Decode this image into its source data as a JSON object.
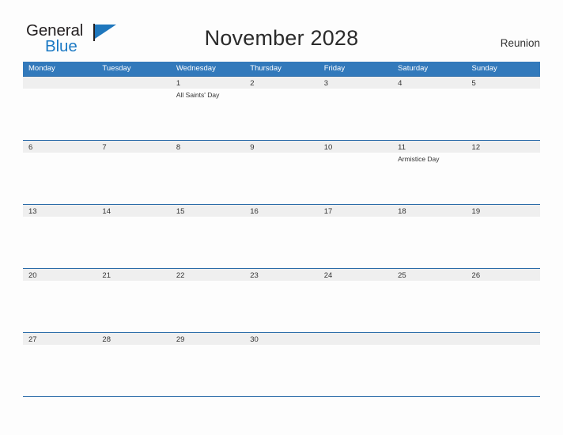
{
  "brand": {
    "name_part1": "General",
    "name_part2": "Blue",
    "flag_icon": "flag-icon",
    "accent_color": "#1b79c4"
  },
  "header": {
    "title": "November 2028",
    "region": "Reunion"
  },
  "calendar": {
    "header_color": "#3279bb",
    "stripe_color": "#efefef",
    "separator_color": "#2a6ba8",
    "weekdays": [
      "Monday",
      "Tuesday",
      "Wednesday",
      "Thursday",
      "Friday",
      "Saturday",
      "Sunday"
    ],
    "weeks": [
      [
        {
          "date": "",
          "event": ""
        },
        {
          "date": "",
          "event": ""
        },
        {
          "date": "1",
          "event": "All Saints' Day"
        },
        {
          "date": "2",
          "event": ""
        },
        {
          "date": "3",
          "event": ""
        },
        {
          "date": "4",
          "event": ""
        },
        {
          "date": "5",
          "event": ""
        }
      ],
      [
        {
          "date": "6",
          "event": ""
        },
        {
          "date": "7",
          "event": ""
        },
        {
          "date": "8",
          "event": ""
        },
        {
          "date": "9",
          "event": ""
        },
        {
          "date": "10",
          "event": ""
        },
        {
          "date": "11",
          "event": "Armistice Day"
        },
        {
          "date": "12",
          "event": ""
        }
      ],
      [
        {
          "date": "13",
          "event": ""
        },
        {
          "date": "14",
          "event": ""
        },
        {
          "date": "15",
          "event": ""
        },
        {
          "date": "16",
          "event": ""
        },
        {
          "date": "17",
          "event": ""
        },
        {
          "date": "18",
          "event": ""
        },
        {
          "date": "19",
          "event": ""
        }
      ],
      [
        {
          "date": "20",
          "event": ""
        },
        {
          "date": "21",
          "event": ""
        },
        {
          "date": "22",
          "event": ""
        },
        {
          "date": "23",
          "event": ""
        },
        {
          "date": "24",
          "event": ""
        },
        {
          "date": "25",
          "event": ""
        },
        {
          "date": "26",
          "event": ""
        }
      ],
      [
        {
          "date": "27",
          "event": ""
        },
        {
          "date": "28",
          "event": ""
        },
        {
          "date": "29",
          "event": ""
        },
        {
          "date": "30",
          "event": ""
        },
        {
          "date": "",
          "event": ""
        },
        {
          "date": "",
          "event": ""
        },
        {
          "date": "",
          "event": ""
        }
      ]
    ]
  }
}
